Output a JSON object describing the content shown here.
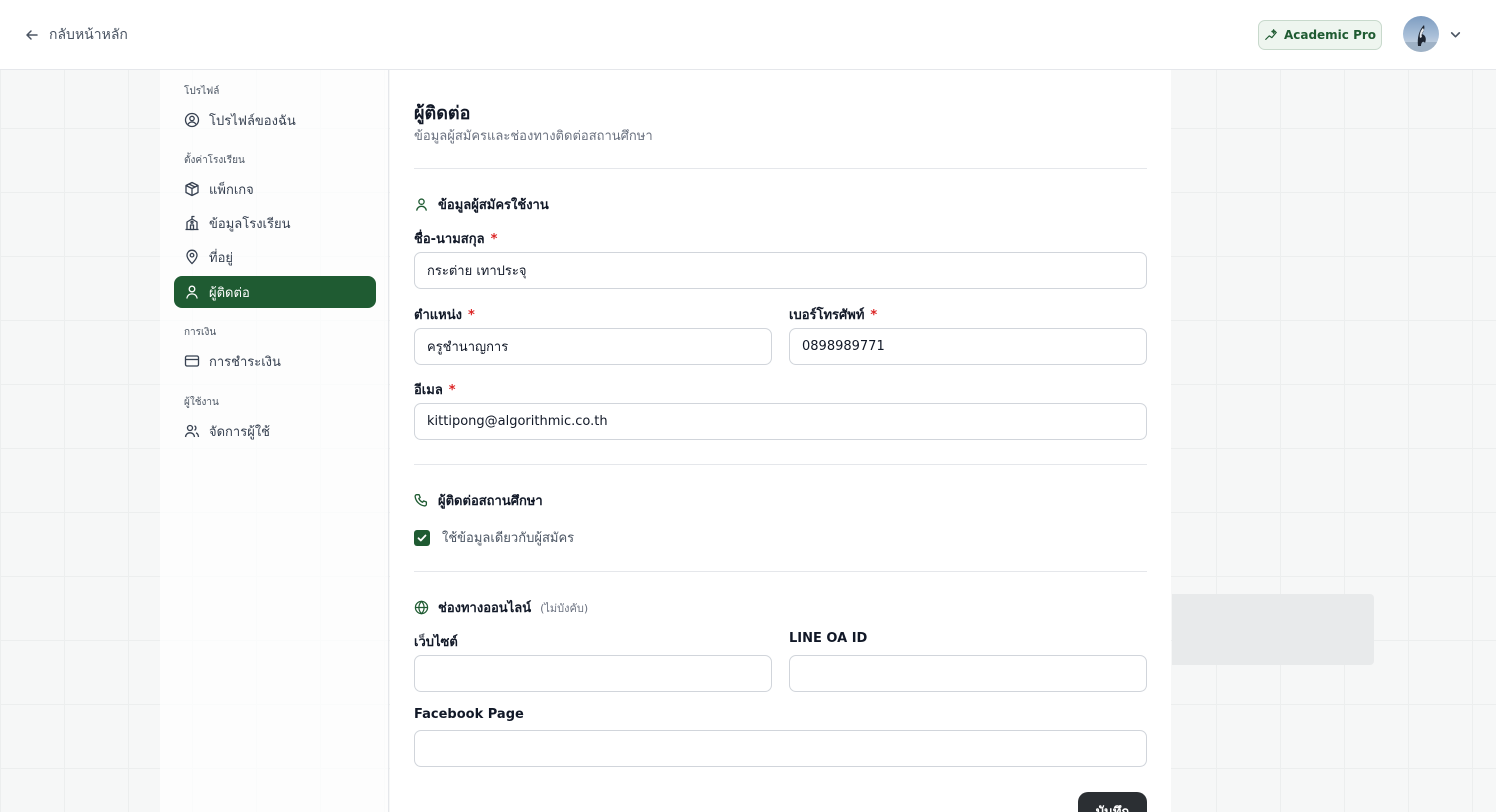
{
  "header": {
    "back_label": "กลับหน้าหลัก",
    "plan_badge": "Academic Pro"
  },
  "sidebar": {
    "groups": [
      {
        "label": "โปรไฟล์",
        "items": [
          {
            "label": "โปรไฟล์ของฉัน",
            "icon": "user-circle-icon"
          }
        ]
      },
      {
        "label": "ตั้งค่าโรงเรียน",
        "items": [
          {
            "label": "แพ็กเกจ",
            "icon": "package-icon"
          },
          {
            "label": "ข้อมูลโรงเรียน",
            "icon": "school-icon"
          },
          {
            "label": "ที่อยู่",
            "icon": "map-pin-icon"
          },
          {
            "label": "ผู้ติดต่อ",
            "icon": "user-icon",
            "active": true
          }
        ]
      },
      {
        "label": "การเงิน",
        "items": [
          {
            "label": "การชำระเงิน",
            "icon": "credit-card-icon"
          }
        ]
      },
      {
        "label": "ผู้ใช้งาน",
        "items": [
          {
            "label": "จัดการผู้ใช้",
            "icon": "users-icon"
          }
        ]
      }
    ]
  },
  "main": {
    "title": "ผู้ติดต่อ",
    "subtitle": "ข้อมูลผู้สมัครและช่องทางติดต่อสถานศึกษา",
    "applicant_section": {
      "title": "ข้อมูลผู้สมัครใช้งาน",
      "fullname_label": "ชื่อ-นามสกุล",
      "fullname_value": "กระต่าย เทาประจุ",
      "position_label": "ตำแหน่ง",
      "position_value": "ครูชำนาญการ",
      "phone_label": "เบอร์โทรศัพท์",
      "phone_value": "0898989771",
      "email_label": "อีเมล",
      "email_value": "kittipong@algorithmic.co.th",
      "required_mark": "*"
    },
    "school_contact_section": {
      "title": "ผู้ติดต่อสถานศึกษา",
      "same_as_applicant_label": "ใช้ข้อมูลเดียวกับผู้สมัคร",
      "same_as_applicant_checked": true
    },
    "online_section": {
      "title": "ช่องทางออนไลน์",
      "optional_note": "(ไม่บังคับ)",
      "website_label": "เว็บไซต์",
      "website_value": "",
      "line_label": "LINE OA ID",
      "line_value": "",
      "facebook_label": "Facebook Page",
      "facebook_value": ""
    },
    "save_label": "บันทึก"
  },
  "colors": {
    "brand": "#1f5b32",
    "required": "#dc2626",
    "save_button": "#2b2f33"
  }
}
